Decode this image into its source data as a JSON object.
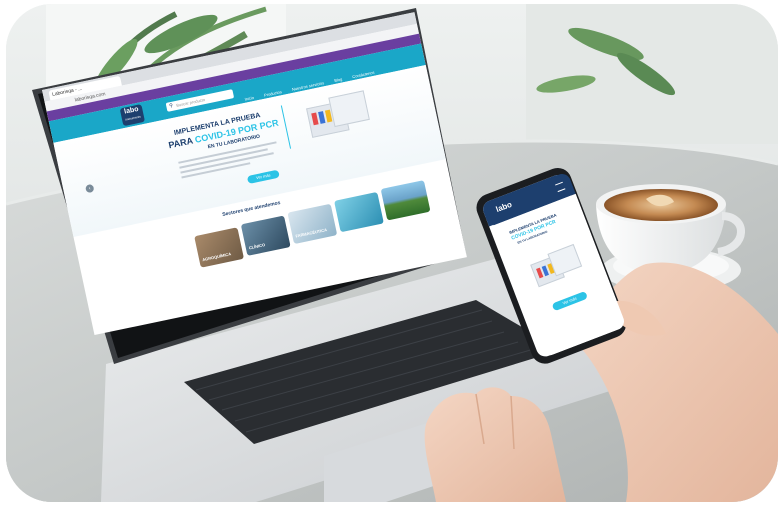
{
  "laptop_site": {
    "browser_tab": "Laborisqa - ...",
    "url": "laborisqa.com",
    "logo_top": "labo",
    "logo_bottom": "instruments",
    "nav": [
      "Inicio",
      "Productos",
      "Nuestros servicios",
      "Blog",
      "Contáctenos"
    ],
    "search_placeholder": "Buscar producto",
    "hero_line1": "IMPLEMENTA LA PRUEBA",
    "hero_line2_prefix": "PARA",
    "hero_line2_highlight": "COVID-19 POR PCR",
    "hero_line3": "EN TU LABORATORIO",
    "hero_button": "Ver más",
    "sections_title": "Sectores que atendemos",
    "category_tiles": [
      "AGROQUÍMICA",
      "CLÍNICO",
      "FARMACÉUTICA",
      "",
      ""
    ]
  },
  "phone_site": {
    "logo_top": "labo",
    "hero_line1": "IMPLEMENTA LA PRUEBA",
    "hero_line2": "COVID-19 POR PCR",
    "hero_line3": "EN TU LABORATORIO",
    "hero_button": "Ver más"
  },
  "colors": {
    "brand_purple": "#6a3fa0",
    "brand_teal": "#1aa7c8",
    "brand_dark": "#1d3f6e",
    "accent_cyan": "#2cc3e6"
  }
}
